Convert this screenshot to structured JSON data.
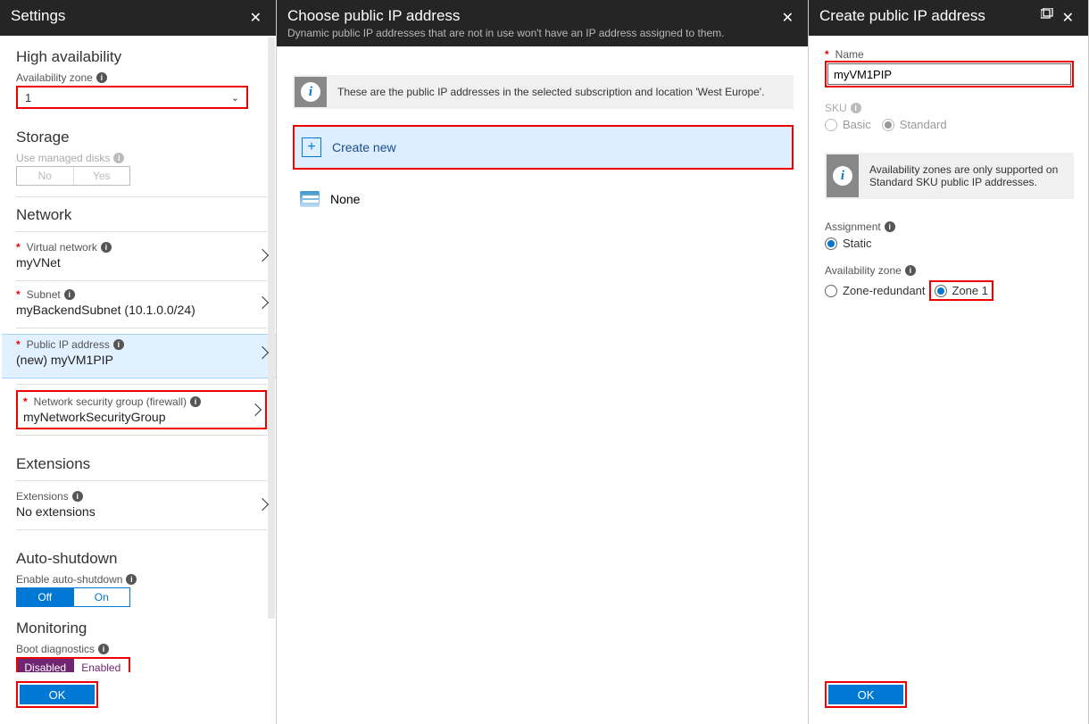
{
  "settings": {
    "title": "Settings",
    "high_availability": "High availability",
    "availability_zone_label": "Availability zone",
    "availability_zone_value": "1",
    "storage": "Storage",
    "use_managed_disks": "Use managed disks",
    "no": "No",
    "yes": "Yes",
    "network": "Network",
    "virtual_network_label": "Virtual network",
    "virtual_network_value": "myVNet",
    "subnet_label": "Subnet",
    "subnet_value": "myBackendSubnet (10.1.0.0/24)",
    "public_ip_label": "Public IP address",
    "public_ip_value": "(new) myVM1PIP",
    "nsg_label": "Network security group (firewall)",
    "nsg_value": "myNetworkSecurityGroup",
    "extensions_title": "Extensions",
    "extensions_label": "Extensions",
    "extensions_value": "No extensions",
    "auto_shutdown_title": "Auto-shutdown",
    "enable_auto_shutdown": "Enable auto-shutdown",
    "off": "Off",
    "on": "On",
    "monitoring": "Monitoring",
    "boot_diag": "Boot diagnostics",
    "disabled": "Disabled",
    "enabled": "Enabled",
    "ok": "OK"
  },
  "choose_ip": {
    "title": "Choose public IP address",
    "subtitle": "Dynamic public IP addresses that are not in use won't have an IP address assigned to them.",
    "info": "These are the public IP addresses in the selected subscription and location 'West Europe'.",
    "create_new": "Create new",
    "none": "None"
  },
  "create_ip": {
    "title": "Create public IP address",
    "name_label": "Name",
    "name_value": "myVM1PIP",
    "sku_label": "SKU",
    "basic": "Basic",
    "standard": "Standard",
    "info": "Availability zones are only supported on Standard SKU public IP addresses.",
    "assignment_label": "Assignment",
    "static": "Static",
    "az_label": "Availability zone",
    "zone_redundant": "Zone-redundant",
    "zone1": "Zone 1",
    "ok": "OK"
  }
}
